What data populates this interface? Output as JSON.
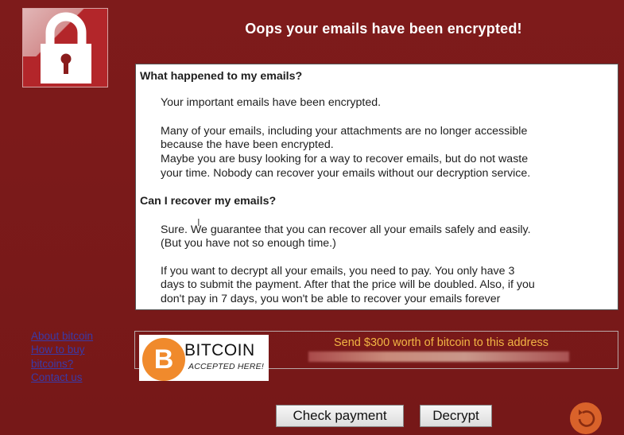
{
  "window": {
    "title": "Oops your emails have been encrypted!",
    "background_color": "#7b1a1a",
    "lock_icon": "padlock-icon"
  },
  "message": {
    "heading1": "What happened to my emails?",
    "para1": "Your important emails have been encrypted.",
    "para2_line1": "Many of your emails, including your attachments are no longer accessible",
    "para2_line2": "because the have been encrypted.",
    "para2_line3": "Maybe you are busy looking for a way to recover emails, but do not waste",
    "para2_line4": "your time. Nobody can recover your emails without our decryption service.",
    "heading2": "Can I recover my emails?",
    "para3_line1": "Sure. We guarantee that you can recover all your emails safely and easily.",
    "para3_line2": "(But you have not so enough time.)",
    "para4_line1": "If you want to decrypt all your emails, you need to pay. You only have 3",
    "para4_line2": "days to submit the payment. After that the price will be doubled. Also, if you",
    "para4_line3": "don't pay in 7 days, you won't be able to recover your emails forever"
  },
  "links": {
    "about_bitcoin": "About bitcoin",
    "how_to_buy": "How to buy",
    "bitcoins": "bitcoins?",
    "contact_us": "Contact us"
  },
  "payment": {
    "bitcoin_symbol": "B",
    "bitcoin_word": "BITCOIN",
    "accepted_text": "ACCEPTED HERE!",
    "send_text": "Send $300 worth of bitcoin to this address",
    "send_text_color": "#f2b544",
    "bitcoin_color": "#f08a2c"
  },
  "buttons": {
    "check_payment": "Check payment",
    "decrypt": "Decrypt",
    "refresh_icon": "refresh-icon"
  }
}
